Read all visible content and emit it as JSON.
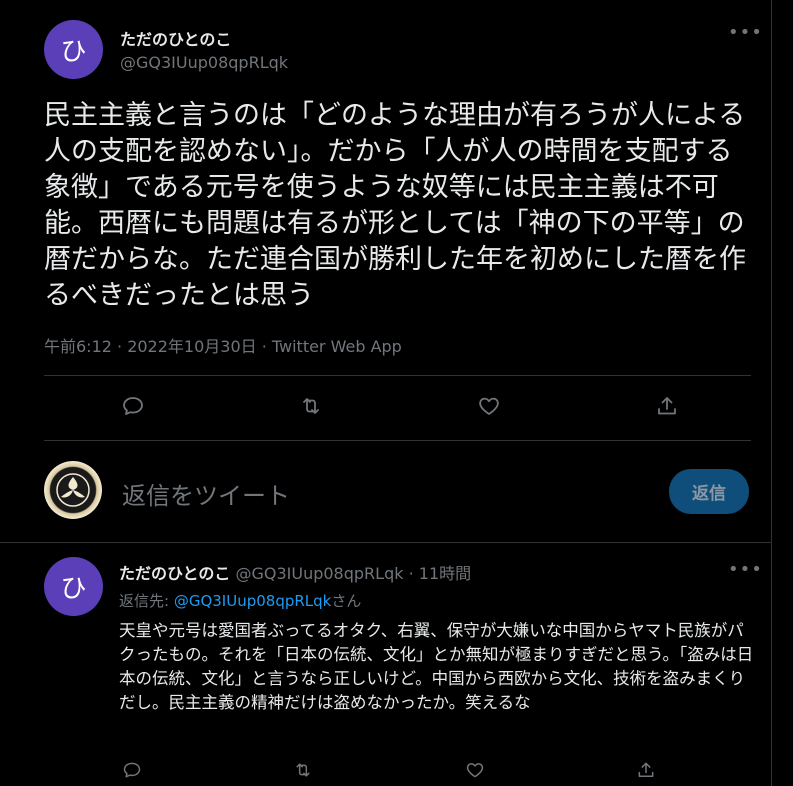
{
  "tweet": {
    "avatar_char": "ひ",
    "display_name": "ただのひとのこ",
    "handle": "@GQ3IUup08qpRLqk",
    "text": "民主主義と言うのは「どのような理由が有ろうが人による人の支配を認めない」。だから「人が人の時間を支配する象徴」である元号を使うような奴等には民主主義は不可能。西暦にも問題は有るが形としては「神の下の平等」の暦だからな。ただ連合国が勝利した年を初めにした暦を作るべきだったとは思う",
    "meta": "午前6:12 · 2022年10月30日 · Twitter Web App"
  },
  "composer": {
    "placeholder": "返信をツイート",
    "reply_label": "返信"
  },
  "reply": {
    "avatar_char": "ひ",
    "display_name": "ただのひとのこ",
    "handle": "@GQ3IUup08qpRLqk",
    "separator": "·",
    "time": "11時間",
    "replying_prefix": "返信先: ",
    "replying_mention": "@GQ3IUup08qpRLqk",
    "replying_suffix": "さん",
    "text": "天皇や元号は愛国者ぶってるオタク、右翼、保守が大嫌いな中国からヤマト民族がパクったもの。それを「日本の伝統、文化」とか無知が極まりすぎだと思う。「盗みは日本の伝統、文化」と言うなら正しいけど。中国から西欧から文化、技術を盗みまくりだし。民主主義の精神だけは盗めなかったか。笑えるな"
  },
  "icons": {
    "more": "more-icon",
    "reply": "reply-icon",
    "retweet": "retweet-icon",
    "like": "like-icon",
    "share": "share-icon"
  },
  "colors": {
    "background": "#000000",
    "text": "#e7e9ea",
    "muted": "#71767b",
    "accent": "#1d9bf0",
    "avatar": "#5b3fb8",
    "reply_button": "#0f4e7a"
  }
}
